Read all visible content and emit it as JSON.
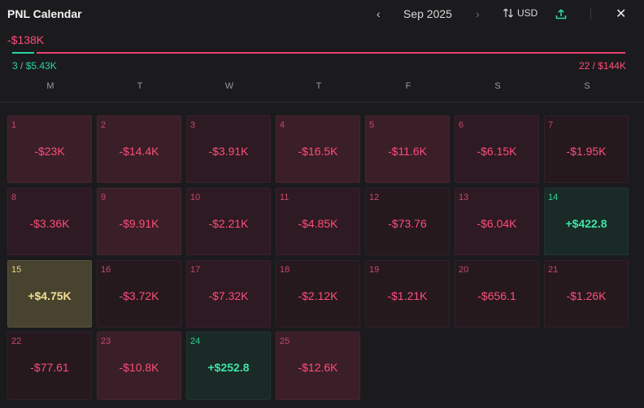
{
  "header": {
    "title": "PNL Calendar",
    "prev_icon": "chevron-left-icon",
    "next_icon": "chevron-right-icon",
    "month": "Sep 2025",
    "currency": "USD",
    "currency_icon": "sort-arrows-icon",
    "share_icon": "upload-icon",
    "close_icon": "close-icon"
  },
  "summary": {
    "total": "-$138K",
    "win_count": "3",
    "win_amount": "$5.43K",
    "loss_label": "22 / $144K",
    "win_fraction": 0.04,
    "colors": {
      "positive": "#2bd49a",
      "negative": "#ff4d7a"
    }
  },
  "weekdays": [
    "M",
    "T",
    "W",
    "T",
    "F",
    "S",
    "S"
  ],
  "days": [
    {
      "day": "1",
      "value": "-$23K",
      "tone": "neg1"
    },
    {
      "day": "2",
      "value": "-$14.4K",
      "tone": "neg1"
    },
    {
      "day": "3",
      "value": "-$3.91K",
      "tone": "neg2"
    },
    {
      "day": "4",
      "value": "-$16.5K",
      "tone": "neg1"
    },
    {
      "day": "5",
      "value": "-$11.6K",
      "tone": "neg1"
    },
    {
      "day": "6",
      "value": "-$6.15K",
      "tone": "neg2"
    },
    {
      "day": "7",
      "value": "-$1.95K",
      "tone": "neg3"
    },
    {
      "day": "8",
      "value": "-$3.36K",
      "tone": "neg2"
    },
    {
      "day": "9",
      "value": "-$9.91K",
      "tone": "neg1"
    },
    {
      "day": "10",
      "value": "-$2.21K",
      "tone": "neg2"
    },
    {
      "day": "11",
      "value": "-$4.85K",
      "tone": "neg2"
    },
    {
      "day": "12",
      "value": "-$73.76",
      "tone": "neg3"
    },
    {
      "day": "13",
      "value": "-$6.04K",
      "tone": "neg2"
    },
    {
      "day": "14",
      "value": "+$422.8",
      "tone": "pos"
    },
    {
      "day": "15",
      "value": "+$4.75K",
      "tone": "gold"
    },
    {
      "day": "16",
      "value": "-$3.72K",
      "tone": "neg3"
    },
    {
      "day": "17",
      "value": "-$7.32K",
      "tone": "neg2"
    },
    {
      "day": "18",
      "value": "-$2.12K",
      "tone": "neg3"
    },
    {
      "day": "19",
      "value": "-$1.21K",
      "tone": "neg3"
    },
    {
      "day": "20",
      "value": "-$656.1",
      "tone": "neg3"
    },
    {
      "day": "21",
      "value": "-$1.26K",
      "tone": "neg3"
    },
    {
      "day": "22",
      "value": "-$77.61",
      "tone": "neg3"
    },
    {
      "day": "23",
      "value": "-$10.8K",
      "tone": "neg1"
    },
    {
      "day": "24",
      "value": "+$252.8",
      "tone": "pos"
    },
    {
      "day": "25",
      "value": "-$12.6K",
      "tone": "neg1"
    }
  ]
}
